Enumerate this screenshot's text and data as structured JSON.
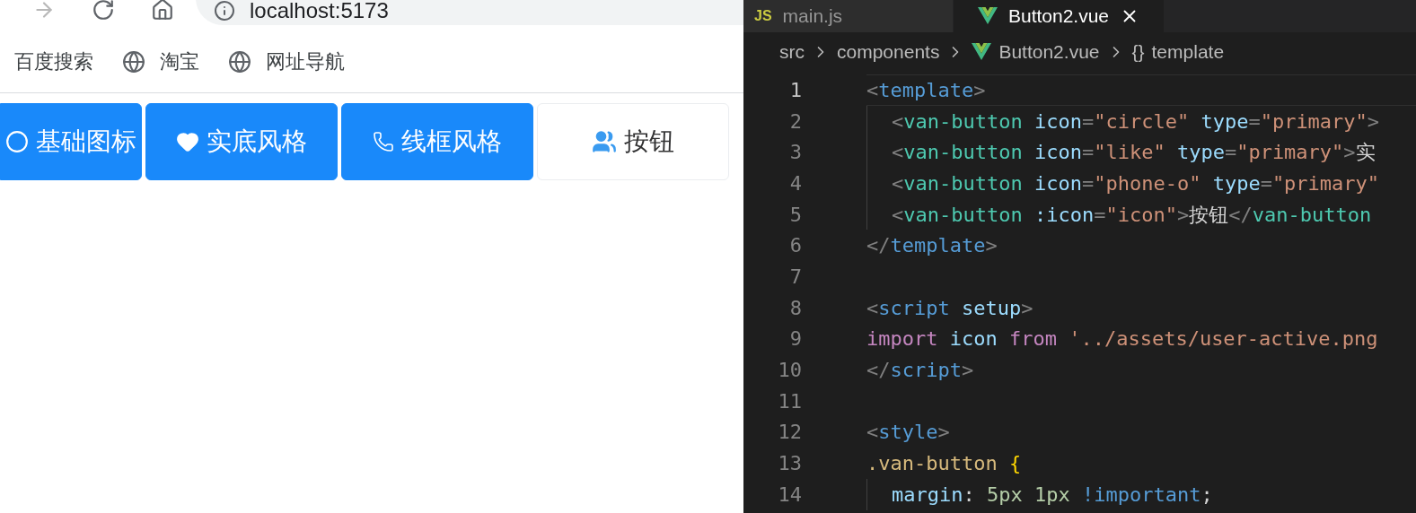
{
  "browser": {
    "address": "localhost:5173",
    "bookmarks": [
      {
        "label": "百度搜索"
      },
      {
        "label": "淘宝"
      },
      {
        "label": "网址导航"
      }
    ]
  },
  "page": {
    "buttons": [
      {
        "label": "基础图标",
        "kind": "primary"
      },
      {
        "label": "实底风格",
        "kind": "primary"
      },
      {
        "label": "线框风格",
        "kind": "primary"
      },
      {
        "label": "按钮",
        "kind": "default"
      }
    ]
  },
  "editor": {
    "tabs": [
      {
        "label": "main.js",
        "badge": "JS",
        "selected": false
      },
      {
        "label": "Button2.vue",
        "selected": true
      }
    ],
    "breadcrumbs": [
      {
        "label": "src",
        "kind": "folder"
      },
      {
        "label": "components",
        "kind": "folder"
      },
      {
        "label": "Button2.vue",
        "kind": "vue"
      },
      {
        "label": "template",
        "kind": "symbol",
        "symbol": "{}"
      }
    ],
    "lines": [
      {
        "number": "1",
        "current": true,
        "indent_guide": false,
        "tokens": [
          {
            "kind": "punct",
            "text": "<"
          },
          {
            "kind": "tag",
            "text": "template"
          },
          {
            "kind": "punct",
            "text": ">"
          }
        ]
      },
      {
        "number": "2",
        "current": false,
        "indent_guide": true,
        "tokens": [
          {
            "kind": "punct",
            "text": "<"
          },
          {
            "kind": "component",
            "text": "van-button "
          },
          {
            "kind": "attr",
            "text": "icon"
          },
          {
            "kind": "punct",
            "text": "="
          },
          {
            "kind": "string",
            "text": "\"circle\" "
          },
          {
            "kind": "attr",
            "text": "type"
          },
          {
            "kind": "punct",
            "text": "="
          },
          {
            "kind": "string",
            "text": "\"primary\""
          },
          {
            "kind": "punct",
            "text": ">"
          }
        ]
      },
      {
        "number": "3",
        "current": false,
        "indent_guide": true,
        "tokens": [
          {
            "kind": "punct",
            "text": "<"
          },
          {
            "kind": "component",
            "text": "van-button "
          },
          {
            "kind": "attr",
            "text": "icon"
          },
          {
            "kind": "punct",
            "text": "="
          },
          {
            "kind": "string",
            "text": "\"like\" "
          },
          {
            "kind": "attr",
            "text": "type"
          },
          {
            "kind": "punct",
            "text": "="
          },
          {
            "kind": "string",
            "text": "\"primary\""
          },
          {
            "kind": "punct",
            "text": ">"
          },
          {
            "kind": "text",
            "text": "实"
          }
        ]
      },
      {
        "number": "4",
        "current": false,
        "indent_guide": true,
        "tokens": [
          {
            "kind": "punct",
            "text": "<"
          },
          {
            "kind": "component",
            "text": "van-button "
          },
          {
            "kind": "attr",
            "text": "icon"
          },
          {
            "kind": "punct",
            "text": "="
          },
          {
            "kind": "string",
            "text": "\"phone-o\" "
          },
          {
            "kind": "attr",
            "text": "type"
          },
          {
            "kind": "punct",
            "text": "="
          },
          {
            "kind": "string",
            "text": "\"primary\""
          }
        ]
      },
      {
        "number": "5",
        "current": false,
        "indent_guide": true,
        "tokens": [
          {
            "kind": "punct",
            "text": "<"
          },
          {
            "kind": "component",
            "text": "van-button "
          },
          {
            "kind": "attr",
            "text": ":icon"
          },
          {
            "kind": "punct",
            "text": "="
          },
          {
            "kind": "string",
            "text": "\"icon\""
          },
          {
            "kind": "punct",
            "text": ">"
          },
          {
            "kind": "text",
            "text": "按钮"
          },
          {
            "kind": "punct",
            "text": "</"
          },
          {
            "kind": "component",
            "text": "van-button"
          }
        ]
      },
      {
        "number": "6",
        "current": false,
        "indent_guide": false,
        "tokens": [
          {
            "kind": "punct",
            "text": "</"
          },
          {
            "kind": "tag",
            "text": "template"
          },
          {
            "kind": "punct",
            "text": ">"
          }
        ]
      },
      {
        "number": "7",
        "current": false,
        "indent_guide": false
      },
      {
        "number": "8",
        "current": false,
        "indent_guide": false,
        "tokens": [
          {
            "kind": "punct",
            "text": "<"
          },
          {
            "kind": "tag",
            "text": "script "
          },
          {
            "kind": "attr",
            "text": "setup"
          },
          {
            "kind": "punct",
            "text": ">"
          }
        ]
      },
      {
        "number": "9",
        "current": false,
        "indent_guide": false,
        "tokens": [
          {
            "kind": "keyword",
            "text": "import "
          },
          {
            "kind": "variable",
            "text": "icon "
          },
          {
            "kind": "keyword",
            "text": "from "
          },
          {
            "kind": "string",
            "text": "'../assets/user-active.png"
          }
        ]
      },
      {
        "number": "10",
        "current": false,
        "indent_guide": false,
        "tokens": [
          {
            "kind": "punct",
            "text": "</"
          },
          {
            "kind": "tag",
            "text": "script"
          },
          {
            "kind": "punct",
            "text": ">"
          }
        ]
      },
      {
        "number": "11",
        "current": false,
        "indent_guide": false
      },
      {
        "number": "12",
        "current": false,
        "indent_guide": false,
        "tokens": [
          {
            "kind": "punct",
            "text": "<"
          },
          {
            "kind": "tag",
            "text": "style"
          },
          {
            "kind": "punct",
            "text": ">"
          }
        ]
      },
      {
        "number": "13",
        "current": false,
        "indent_guide": false,
        "tokens": [
          {
            "kind": "selector",
            "text": ".van-button "
          },
          {
            "kind": "brace",
            "text": "{"
          }
        ]
      },
      {
        "number": "14",
        "current": false,
        "indent_guide": true,
        "tokens": [
          {
            "kind": "attr",
            "text": "margin"
          },
          {
            "kind": "text",
            "text": ": "
          },
          {
            "kind": "number",
            "text": "5px 1px "
          },
          {
            "kind": "tag",
            "text": "!important"
          },
          {
            "kind": "text",
            "text": ";"
          }
        ]
      }
    ]
  }
}
